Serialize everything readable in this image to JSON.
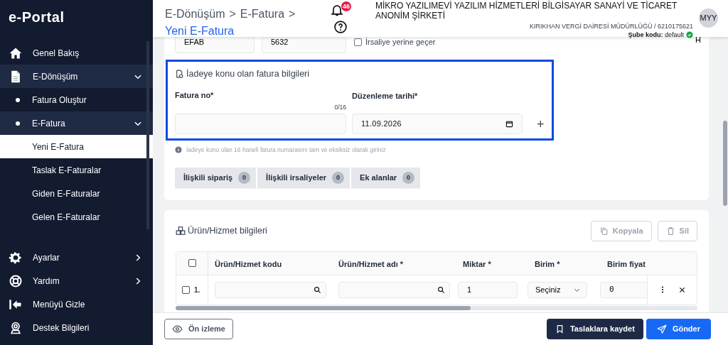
{
  "sidebar": {
    "logo": "e-Portal",
    "items": [
      {
        "label": "Genel Bakış",
        "kind": "home",
        "selected": false
      },
      {
        "label": "E-Dönüşüm",
        "kind": "file",
        "selected": false,
        "expanded": true,
        "children": [
          {
            "label": "Fatura Oluştur",
            "selected": false
          },
          {
            "label": "E-Fatura",
            "selected": false,
            "expanded": true,
            "children": [
              {
                "label": "Yeni E-Fatura",
                "selected": true
              },
              {
                "label": "Taslak E-Faturalar",
                "selected": false
              },
              {
                "label": "Giden E-Faturalar",
                "selected": false
              },
              {
                "label": "Gelen E-Faturalar",
                "selected": false
              }
            ]
          }
        ]
      }
    ],
    "bottom_items": [
      {
        "label": "Ayarlar",
        "kind": "gear",
        "selected": false,
        "expanded": false
      },
      {
        "label": "Yardım",
        "kind": "lifebuoy",
        "selected": false,
        "expanded": false
      },
      {
        "label": "Menüyü Gizle",
        "kind": "collapse",
        "selected": false
      },
      {
        "label": "Destek Bilgileri",
        "kind": "support",
        "selected": false
      }
    ]
  },
  "header": {
    "breadcrumb": [
      "E-Dönüşüm",
      "E-Fatura"
    ],
    "separator": ">",
    "current": "Yeni E-Fatura",
    "notification_count": "46",
    "company": "MİKRO YAZILIMEVİ YAZILIM HİZMETLERİ BİLGİSAYAR SANAYİ VE TİCARET ANONİM ŞİRKETİ",
    "tax_office": "KIRIKHAN VERGİ DAİRESİ MÜDÜRLÜĞÜ / 6210175621",
    "branch": "**Şube kodu:** default",
    "avatar": "MYY"
  },
  "invoice_card": {
    "series": "EFAB",
    "number": "5632",
    "waybill_checkbox": {
      "label": "İrsaliye yerine geçer",
      "checked": false
    },
    "column_3": "H",
    "return_section": {
      "title": "İadeye konu olan fatura bilgileri",
      "invoice_no_label": "Fatura no*",
      "counter": "0/16",
      "date_label": "Düzenleme tarihi*",
      "date": "11.09.2026",
      "add": "+"
    },
    "hint": "İadeye konu olan 16 haneli fatura numarasını tam ve eksiksiz olarak giriniz",
    "tabs": [
      {
        "label": "İlişkili sipariş",
        "count": "0",
        "selected": false
      },
      {
        "label": "İlişkili irsaliyeler",
        "count": "0",
        "selected": false
      },
      {
        "label": "Ek alanlar",
        "count": "0",
        "selected": false
      }
    ]
  },
  "products": {
    "title": "Ürün/Hizmet bilgileri",
    "buttons": [
      {
        "label": "Kopyala",
        "kind": "copy",
        "disabled": true
      },
      {
        "label": "Sil",
        "kind": "trash",
        "disabled": true
      }
    ],
    "all_checked": false,
    "columns": [
      "Ürün/Hizmet kodu",
      "Ürün/Hizmet adı *",
      "Miktar *",
      "Birim *",
      "Birim fiyat"
    ],
    "rows": [
      {
        "checked": false,
        "number": "1.",
        "quantity": "1",
        "unit": "Seçiniz",
        "price": "0"
      }
    ]
  },
  "footer": {
    "preview": "Ön izleme",
    "save": "Taslaklara kaydet",
    "send": "Gönder"
  }
}
